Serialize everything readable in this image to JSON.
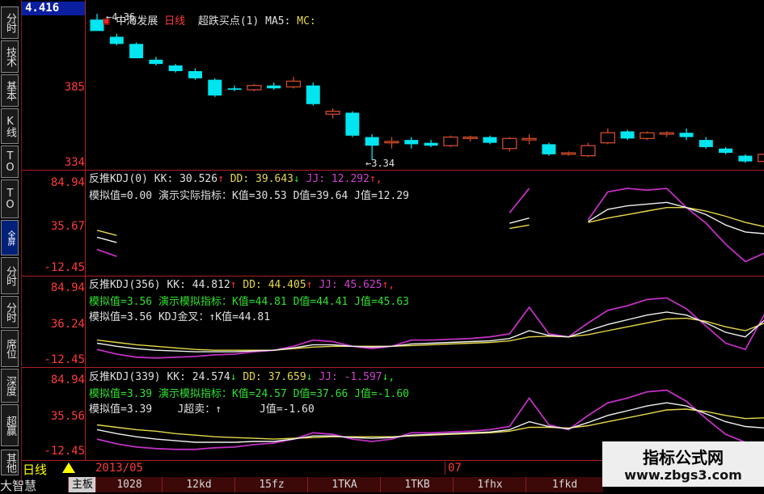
{
  "window": {
    "current_price": "4.416"
  },
  "sidebar": {
    "items": [
      {
        "label": "分时"
      },
      {
        "label": "技术"
      },
      {
        "label": "基本"
      },
      {
        "label": "K线"
      },
      {
        "label": "TO"
      },
      {
        "label": "TO"
      },
      {
        "label": "全屏"
      },
      {
        "label": "分时"
      },
      {
        "label": "分时"
      },
      {
        "label": "席位"
      },
      {
        "label": "深度"
      },
      {
        "label": "超赢"
      },
      {
        "label": "其他"
      }
    ]
  },
  "main_chart": {
    "title": {
      "stock": "中海发展",
      "period": "日线",
      "indicator": "超跌买点(1)",
      "ma5": "MA5:",
      "mc": "MC:"
    },
    "axis_labels": [
      "385",
      "334"
    ],
    "high_label": "4.36",
    "low_label": "3.34",
    "colors": {
      "up": "#d04a2a",
      "down": "#00e5f0"
    },
    "candles": [
      {
        "o": 4.32,
        "h": 4.36,
        "l": 4.26,
        "c": 4.24
      },
      {
        "o": 4.2,
        "h": 4.22,
        "l": 4.14,
        "c": 4.15
      },
      {
        "o": 4.15,
        "h": 4.16,
        "l": 4.05,
        "c": 4.05
      },
      {
        "o": 4.04,
        "h": 4.06,
        "l": 4.0,
        "c": 4.01
      },
      {
        "o": 4.0,
        "h": 4.01,
        "l": 3.95,
        "c": 3.96
      },
      {
        "o": 3.96,
        "h": 3.98,
        "l": 3.9,
        "c": 3.91
      },
      {
        "o": 3.9,
        "h": 3.91,
        "l": 3.78,
        "c": 3.79
      },
      {
        "o": 3.84,
        "h": 3.86,
        "l": 3.82,
        "c": 3.83
      },
      {
        "o": 3.83,
        "h": 3.87,
        "l": 3.82,
        "c": 3.86
      },
      {
        "o": 3.86,
        "h": 3.88,
        "l": 3.83,
        "c": 3.84
      },
      {
        "o": 3.85,
        "h": 3.92,
        "l": 3.84,
        "c": 3.89
      },
      {
        "o": 3.86,
        "h": 3.88,
        "l": 3.72,
        "c": 3.73
      },
      {
        "o": 3.66,
        "h": 3.7,
        "l": 3.63,
        "c": 3.68
      },
      {
        "o": 3.67,
        "h": 3.68,
        "l": 3.5,
        "c": 3.51
      },
      {
        "o": 3.5,
        "h": 3.52,
        "l": 3.34,
        "c": 3.44
      },
      {
        "o": 3.46,
        "h": 3.5,
        "l": 3.42,
        "c": 3.47
      },
      {
        "o": 3.48,
        "h": 3.5,
        "l": 3.42,
        "c": 3.45
      },
      {
        "o": 3.46,
        "h": 3.48,
        "l": 3.43,
        "c": 3.44
      },
      {
        "o": 3.44,
        "h": 3.51,
        "l": 3.43,
        "c": 3.5
      },
      {
        "o": 3.49,
        "h": 3.51,
        "l": 3.47,
        "c": 3.5
      },
      {
        "o": 3.5,
        "h": 3.51,
        "l": 3.45,
        "c": 3.46
      },
      {
        "o": 3.42,
        "h": 3.5,
        "l": 3.4,
        "c": 3.49
      },
      {
        "o": 3.48,
        "h": 3.52,
        "l": 3.45,
        "c": 3.49
      },
      {
        "o": 3.45,
        "h": 3.46,
        "l": 3.37,
        "c": 3.38
      },
      {
        "o": 3.38,
        "h": 3.4,
        "l": 3.37,
        "c": 3.39
      },
      {
        "o": 3.37,
        "h": 3.46,
        "l": 3.36,
        "c": 3.44
      },
      {
        "o": 3.46,
        "h": 3.56,
        "l": 3.45,
        "c": 3.53
      },
      {
        "o": 3.54,
        "h": 3.55,
        "l": 3.48,
        "c": 3.49
      },
      {
        "o": 3.49,
        "h": 3.54,
        "l": 3.48,
        "c": 3.53
      },
      {
        "o": 3.52,
        "h": 3.54,
        "l": 3.5,
        "c": 3.53
      },
      {
        "o": 3.53,
        "h": 3.56,
        "l": 3.48,
        "c": 3.5
      },
      {
        "o": 3.48,
        "h": 3.5,
        "l": 3.42,
        "c": 3.43
      },
      {
        "o": 3.42,
        "h": 3.43,
        "l": 3.38,
        "c": 3.39
      },
      {
        "o": 3.37,
        "h": 3.38,
        "l": 3.32,
        "c": 3.33
      },
      {
        "o": 3.33,
        "h": 3.39,
        "l": 3.33,
        "c": 3.38
      }
    ]
  },
  "panels": [
    {
      "header": {
        "name": "反推KDJ(0)",
        "kk": "KK: 30.526",
        "kk_arrow": "↑",
        "dd": "DD: 39.643",
        "dd_arrow": "↓",
        "jj": "JJ: 12.292",
        "jj_arrow": "↑,"
      },
      "line2": "模拟值=0.00 演示实际指标：K值=30.53 D值=39.64 J值=12.29",
      "line3": "",
      "axis_labels": [
        "84.94",
        "35.67",
        "-12.45"
      ],
      "segments": [
        [
          0,
          2
        ],
        [
          21,
          23
        ],
        [
          25,
          35
        ]
      ],
      "k": [
        28,
        22,
        18,
        20,
        26,
        32,
        34,
        30,
        26,
        24,
        26,
        30,
        28,
        24,
        22,
        26,
        30,
        32,
        34,
        38,
        40,
        44,
        50,
        44,
        48,
        46,
        60,
        64,
        66,
        68,
        62,
        54,
        42,
        34,
        32
      ],
      "d": [
        36,
        30,
        26,
        26,
        28,
        30,
        32,
        31,
        29,
        27,
        27,
        28,
        28,
        26,
        25,
        26,
        28,
        30,
        31,
        34,
        36,
        38,
        42,
        42,
        44,
        45,
        50,
        54,
        58,
        62,
        62,
        58,
        52,
        45,
        40
      ],
      "j": [
        14,
        6,
        2,
        8,
        22,
        36,
        38,
        28,
        20,
        18,
        24,
        34,
        28,
        20,
        16,
        26,
        34,
        36,
        40,
        46,
        48,
        56,
        84,
        48,
        56,
        48,
        80,
        84,
        82,
        84,
        62,
        44,
        20,
        0,
        10
      ]
    },
    {
      "header": {
        "name": "反推KDJ(356)",
        "kk": "KK: 44.812",
        "kk_arrow": "↑",
        "dd": "DD: 44.405",
        "dd_arrow": "↑",
        "jj": "JJ: 45.625",
        "jj_arrow": "↑,"
      },
      "line2": "模拟值=3.56 演示模拟指标：K值=44.81 D值=44.41 J值=45.63",
      "line3": "模拟值=3.56 KDJ金叉：↑K值=44.81",
      "axis_labels": [
        "84.94",
        "36.24",
        "-12.45"
      ],
      "segments": [
        [
          0,
          35
        ]
      ],
      "k": [
        14,
        10,
        7,
        5,
        4,
        3,
        3,
        3,
        4,
        5,
        8,
        12,
        12,
        10,
        9,
        10,
        13,
        14,
        15,
        16,
        17,
        20,
        30,
        24,
        22,
        30,
        38,
        44,
        50,
        54,
        50,
        40,
        28,
        22,
        44
      ],
      "d": [
        18,
        15,
        12,
        10,
        8,
        6,
        5,
        5,
        5,
        5,
        7,
        9,
        10,
        10,
        10,
        10,
        11,
        12,
        13,
        14,
        15,
        17,
        22,
        23,
        22,
        25,
        30,
        35,
        40,
        45,
        46,
        42,
        35,
        30,
        40
      ],
      "j": [
        6,
        0,
        -4,
        -5,
        -4,
        -3,
        -1,
        0,
        3,
        5,
        10,
        18,
        16,
        10,
        7,
        10,
        18,
        18,
        19,
        20,
        22,
        26,
        60,
        26,
        22,
        40,
        56,
        62,
        70,
        72,
        58,
        36,
        14,
        6,
        52
      ]
    },
    {
      "header": {
        "name": "反推KDJ(339)",
        "kk": "KK: 24.574",
        "kk_arrow": "↓",
        "dd": "DD: 37.659",
        "dd_arrow": "↓",
        "jj": "JJ: -1.597",
        "jj_arrow": "↓,"
      },
      "line2": "模拟值=3.39 演示模拟指标：K值=24.57 D值=37.66 J值=-1.60",
      "line3": "模拟值=3.39    J超卖：↑      J值=-1.60",
      "axis_labels": [
        "84.94",
        "35.56",
        "-12.45"
      ],
      "segments": [
        [
          0,
          35
        ]
      ],
      "k": [
        22,
        17,
        13,
        10,
        8,
        6,
        6,
        6,
        7,
        7,
        10,
        14,
        14,
        12,
        11,
        12,
        15,
        16,
        17,
        18,
        19,
        22,
        32,
        26,
        23,
        31,
        40,
        46,
        52,
        56,
        52,
        42,
        32,
        26,
        24
      ],
      "d": [
        28,
        25,
        22,
        20,
        17,
        15,
        13,
        12,
        11,
        10,
        11,
        12,
        13,
        13,
        13,
        13,
        14,
        15,
        16,
        17,
        18,
        20,
        25,
        25,
        24,
        27,
        32,
        37,
        42,
        47,
        48,
        45,
        40,
        36,
        37
      ],
      "j": [
        10,
        4,
        0,
        -2,
        -3,
        -3,
        -1,
        0,
        3,
        5,
        10,
        18,
        16,
        10,
        7,
        10,
        18,
        18,
        19,
        20,
        22,
        26,
        62,
        28,
        22,
        40,
        56,
        62,
        70,
        72,
        58,
        36,
        16,
        6,
        -2
      ]
    }
  ],
  "bottom": {
    "mode_label": "日线",
    "brand": "大智慧",
    "dates": [
      "2013/05",
      "07"
    ],
    "tabs": [
      {
        "label": "主板",
        "selected": true
      },
      {
        "label": "1028",
        "selected": false
      },
      {
        "label": "12kd",
        "selected": false
      },
      {
        "label": "15fz",
        "selected": false
      },
      {
        "label": "1TKA",
        "selected": false
      },
      {
        "label": "1TKB",
        "selected": false
      },
      {
        "label": "1fhx",
        "selected": false
      },
      {
        "label": "1fkd",
        "selected": false
      }
    ]
  },
  "watermark": {
    "title": "指标公式网",
    "url": "www.zbgs3.com"
  },
  "colors": {
    "k_line": "#f0f0f0",
    "d_line": "#e6d84a",
    "j_line": "#c030c0",
    "border": "#b02020",
    "axis_text": "#ff3a3a"
  }
}
